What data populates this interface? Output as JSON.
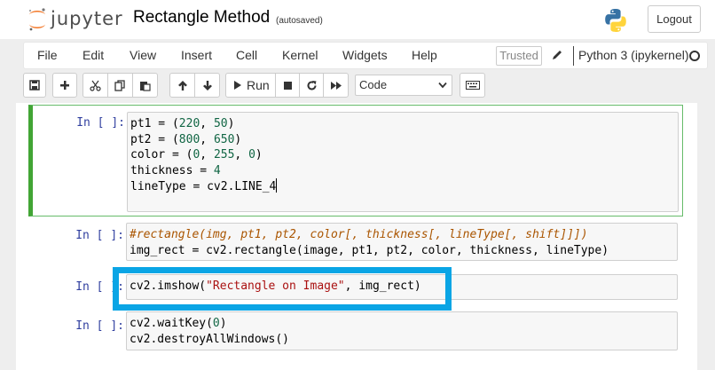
{
  "header": {
    "logo_text": "jupyter",
    "notebook_title": "Rectangle Method",
    "autosave_status": "(autosaved)",
    "logout_label": "Logout"
  },
  "menubar": {
    "items": [
      "File",
      "Edit",
      "View",
      "Insert",
      "Cell",
      "Kernel",
      "Widgets",
      "Help"
    ],
    "trusted_label": "Trusted",
    "kernel_name": "Python 3 (ipykernel)"
  },
  "toolbar": {
    "run_label": "Run",
    "cell_type": "Code",
    "icons": [
      "save-icon",
      "plus-icon",
      "scissors-icon",
      "copy-icon",
      "paste-icon",
      "arrow-up-icon",
      "arrow-down-icon",
      "play-icon",
      "stop-icon",
      "restart-icon",
      "fast-forward-icon",
      "keyboard-icon"
    ]
  },
  "cells": [
    {
      "prompt": "In [ ]:",
      "lines": [
        [
          "pt1 = (",
          "220",
          ", ",
          "50",
          ")"
        ],
        [
          "pt2 = (",
          "800",
          ", ",
          "650",
          ")"
        ],
        [
          "color = (",
          "0",
          ", ",
          "255",
          ", ",
          "0",
          ")"
        ],
        [
          "thickness = ",
          "4"
        ],
        [
          "lineType = cv2.LINE_4"
        ]
      ]
    },
    {
      "prompt": "In [ ]:",
      "comment": "#rectangle(img, pt1, pt2, color[, thickness[, lineType[, shift]]])",
      "code": "img_rect = cv2.rectangle(image, pt1, pt2, color, thickness, lineType)"
    },
    {
      "prompt": "In [ ]:",
      "code_pre": "cv2.imshow(",
      "string": "\"Rectangle on Image\"",
      "code_post": ", img_rect)"
    },
    {
      "prompt": "In [ ]:",
      "line1_pre": "cv2.waitKey(",
      "line1_num": "0",
      "line1_post": ")",
      "line2": "cv2.destroyAllWindows()"
    }
  ],
  "colors": {
    "highlight_box": "#0aa5e5",
    "selected_cell_border": "#42a535",
    "prompt": "#303f9f",
    "number": "#116644",
    "string": "#aa1111",
    "comment": "#aa5500"
  }
}
